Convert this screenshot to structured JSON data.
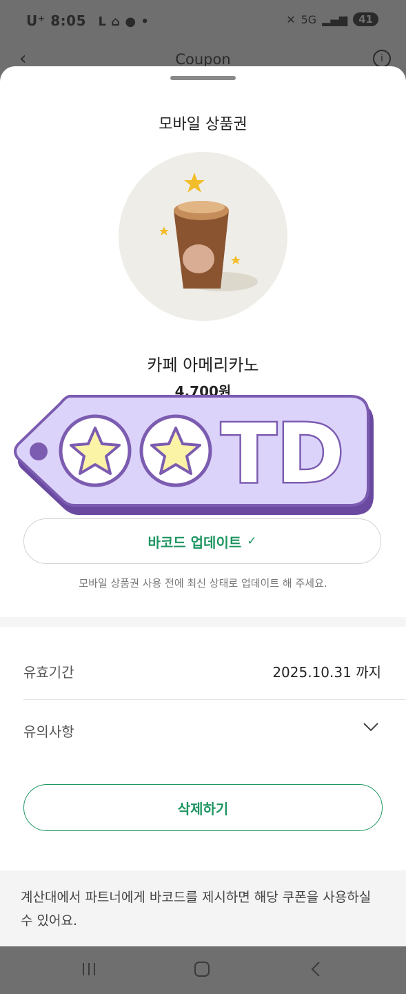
{
  "status_bar": {
    "carrier_time": "U⁺ 8:05",
    "symbols": "L ⌂ ● •",
    "signal": "5G",
    "battery": "41"
  },
  "header": {
    "title": "Coupon"
  },
  "sheet": {
    "title": "모바일 상품권",
    "product_name": "카페 아메리카노",
    "price": "4,700원",
    "sticker_text": "TD",
    "barcode_button": "바코드 업데이트",
    "barcode_note": "모바일 상품권 사용 전에 최신 상태로 업데이트 해 주세요.",
    "validity_label": "유효기간",
    "validity_value": "2025.10.31 까지",
    "notice_label": "유의사항",
    "delete_button": "삭제하기",
    "footer_note": "계산대에서 파트너에게 바코드를 제시하면 해당 쿠폰을 사용하실 수 있어요."
  },
  "colors": {
    "accent": "#1e9560",
    "sticker_fill": "#dcd3fa",
    "sticker_stroke": "#7c5cb0",
    "star": "#fbf3a6"
  },
  "icons": [
    "back-icon",
    "info-icon",
    "check-icon",
    "chevron-down-icon",
    "recents-icon",
    "home-icon",
    "back-nav-icon"
  ]
}
